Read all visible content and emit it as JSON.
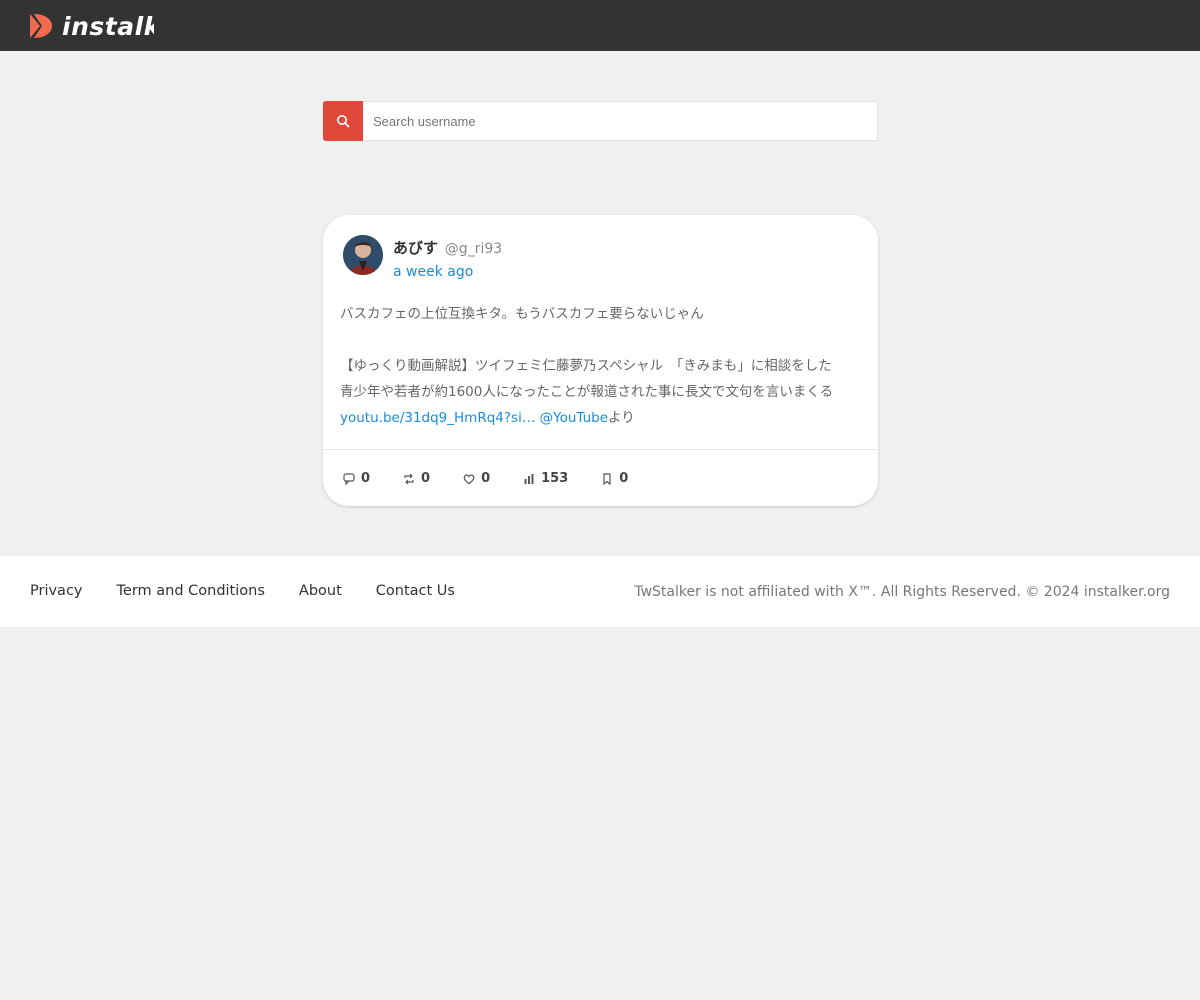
{
  "header": {
    "logo_text": "instalker"
  },
  "search": {
    "placeholder": "Search username"
  },
  "tweet": {
    "display_name": "あびす",
    "handle": "@g_ri93",
    "time_ago": "a week ago",
    "line1": "バスカフェの上位互換キタ。もうバスカフェ要らないじゃん",
    "line2": "【ゆっくり動画解説】ツイフェミ仁藤夢乃スペシャル　「きみまも」に相談をした",
    "line3": "青少年や若者が約1600人になったことが報道された事に長文で文句を言いまくる",
    "link_text": "youtu.be/31dq9_HmRq4?si…",
    "mention_text": "@YouTube",
    "suffix_text": "より",
    "stats": {
      "replies": "0",
      "retweets": "0",
      "likes": "0",
      "views": "153",
      "bookmarks": "0"
    }
  },
  "footer": {
    "links": [
      "Privacy",
      "Term and Conditions",
      "About",
      "Contact Us"
    ],
    "copyright": "TwStalker is not affiliated with X™. All Rights Reserved. © 2024 instalker.org"
  },
  "colors": {
    "header_bg": "#333333",
    "accent": "#e0483a",
    "link": "#1a8cd8",
    "page_bg": "#f0f0f0"
  }
}
